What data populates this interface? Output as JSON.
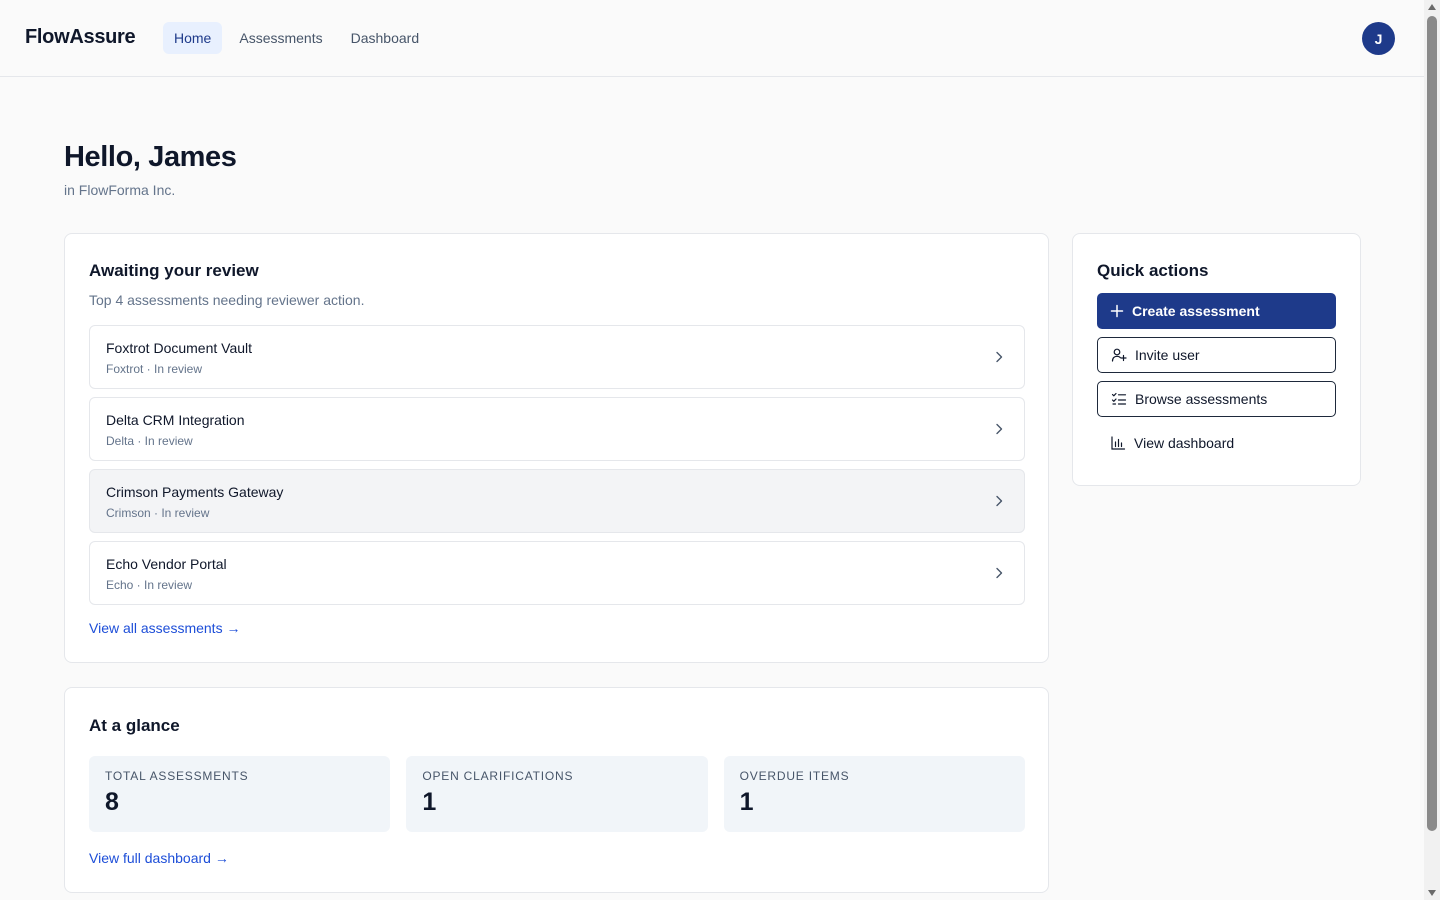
{
  "header": {
    "brand": "FlowAssure",
    "nav": [
      {
        "label": "Home",
        "active": true
      },
      {
        "label": "Assessments",
        "active": false
      },
      {
        "label": "Dashboard",
        "active": false
      }
    ],
    "avatar_initial": "J"
  },
  "greeting": {
    "title": "Hello, James",
    "org": "in FlowForma Inc."
  },
  "review": {
    "title": "Awaiting your review",
    "subtitle": "Top 4 assessments needing reviewer action.",
    "items": [
      {
        "title": "Foxtrot Document Vault",
        "meta": "Foxtrot · In review"
      },
      {
        "title": "Delta CRM Integration",
        "meta": "Delta · In review"
      },
      {
        "title": "Crimson Payments Gateway",
        "meta": "Crimson · In review"
      },
      {
        "title": "Echo Vendor Portal",
        "meta": "Echo · In review"
      }
    ],
    "view_all": "View all assessments →"
  },
  "glance": {
    "title": "At a glance",
    "stats": [
      {
        "label": "TOTAL ASSESSMENTS",
        "value": "8"
      },
      {
        "label": "OPEN CLARIFICATIONS",
        "value": "1"
      },
      {
        "label": "OVERDUE ITEMS",
        "value": "1"
      }
    ],
    "view_full": "View full dashboard →"
  },
  "quick_actions": {
    "title": "Quick actions",
    "create": "Create assessment",
    "invite": "Invite user",
    "browse": "Browse assessments",
    "dashboard": "View dashboard"
  },
  "colors": {
    "primary": "#1e3a8a",
    "link": "#1d4ed8",
    "nav_active_bg": "#e8f0fe"
  }
}
